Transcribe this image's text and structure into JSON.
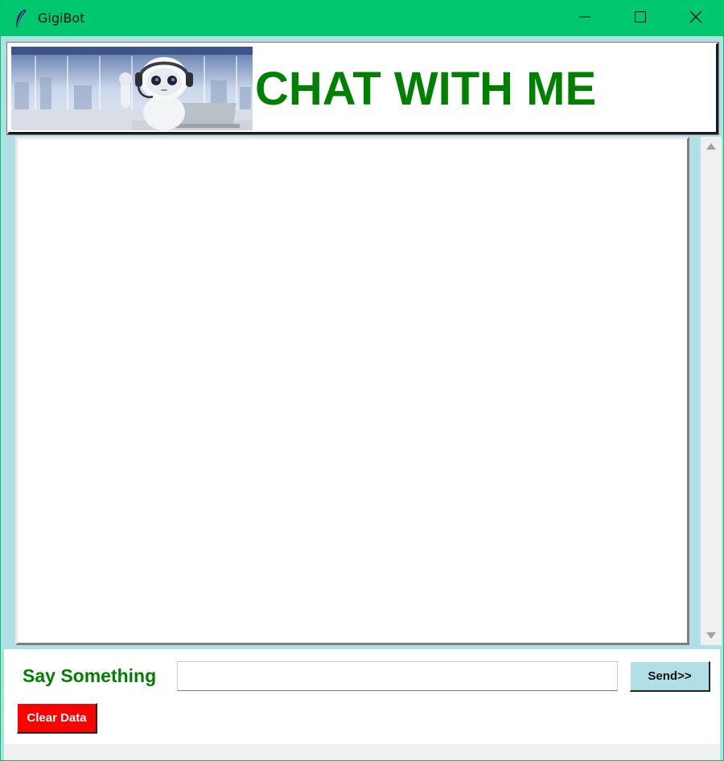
{
  "window": {
    "title": "GigiBot",
    "app_icon": "feather-icon",
    "controls": [
      "minimize-icon",
      "maximize-icon",
      "close-icon"
    ]
  },
  "header": {
    "image": "robot-assistant-image",
    "title": "CHAT WITH ME"
  },
  "chat": {
    "transcript": "",
    "scrollbar": {
      "up": "arrow-up-icon",
      "down": "arrow-down-icon"
    }
  },
  "input_row": {
    "label": "Say Something",
    "message_value": "",
    "send_label": "Send>>",
    "clear_label": "Clear Data"
  },
  "colors": {
    "titlebar": "#00c86e",
    "frame_background": "#b0e0e6",
    "accent_text": "#008000",
    "send_button": "#b0e0e6",
    "clear_button": "#ff0000"
  }
}
